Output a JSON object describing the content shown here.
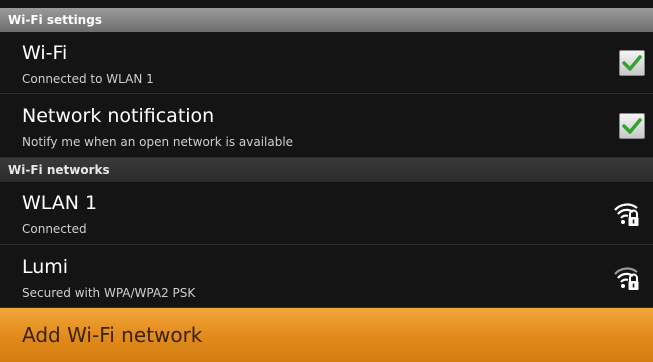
{
  "sections": {
    "wifi_settings": "Wi-Fi settings",
    "wifi_networks": "Wi-Fi networks"
  },
  "settings": [
    {
      "title": "Wi-Fi",
      "summary": "Connected to WLAN 1",
      "checked": true
    },
    {
      "title": "Network notification",
      "summary": "Notify me when an open network is available",
      "checked": true
    }
  ],
  "networks": [
    {
      "name": "WLAN 1",
      "status": "Connected",
      "icon": "wifi-lock-icon"
    },
    {
      "name": "Lumi",
      "status": "Secured with WPA/WPA2 PSK",
      "icon": "wifi-lock-icon"
    }
  ],
  "add_network": {
    "label": "Add Wi-Fi network"
  },
  "colors": {
    "accent": "#e08a1a",
    "check_green": "#2fa52f"
  }
}
